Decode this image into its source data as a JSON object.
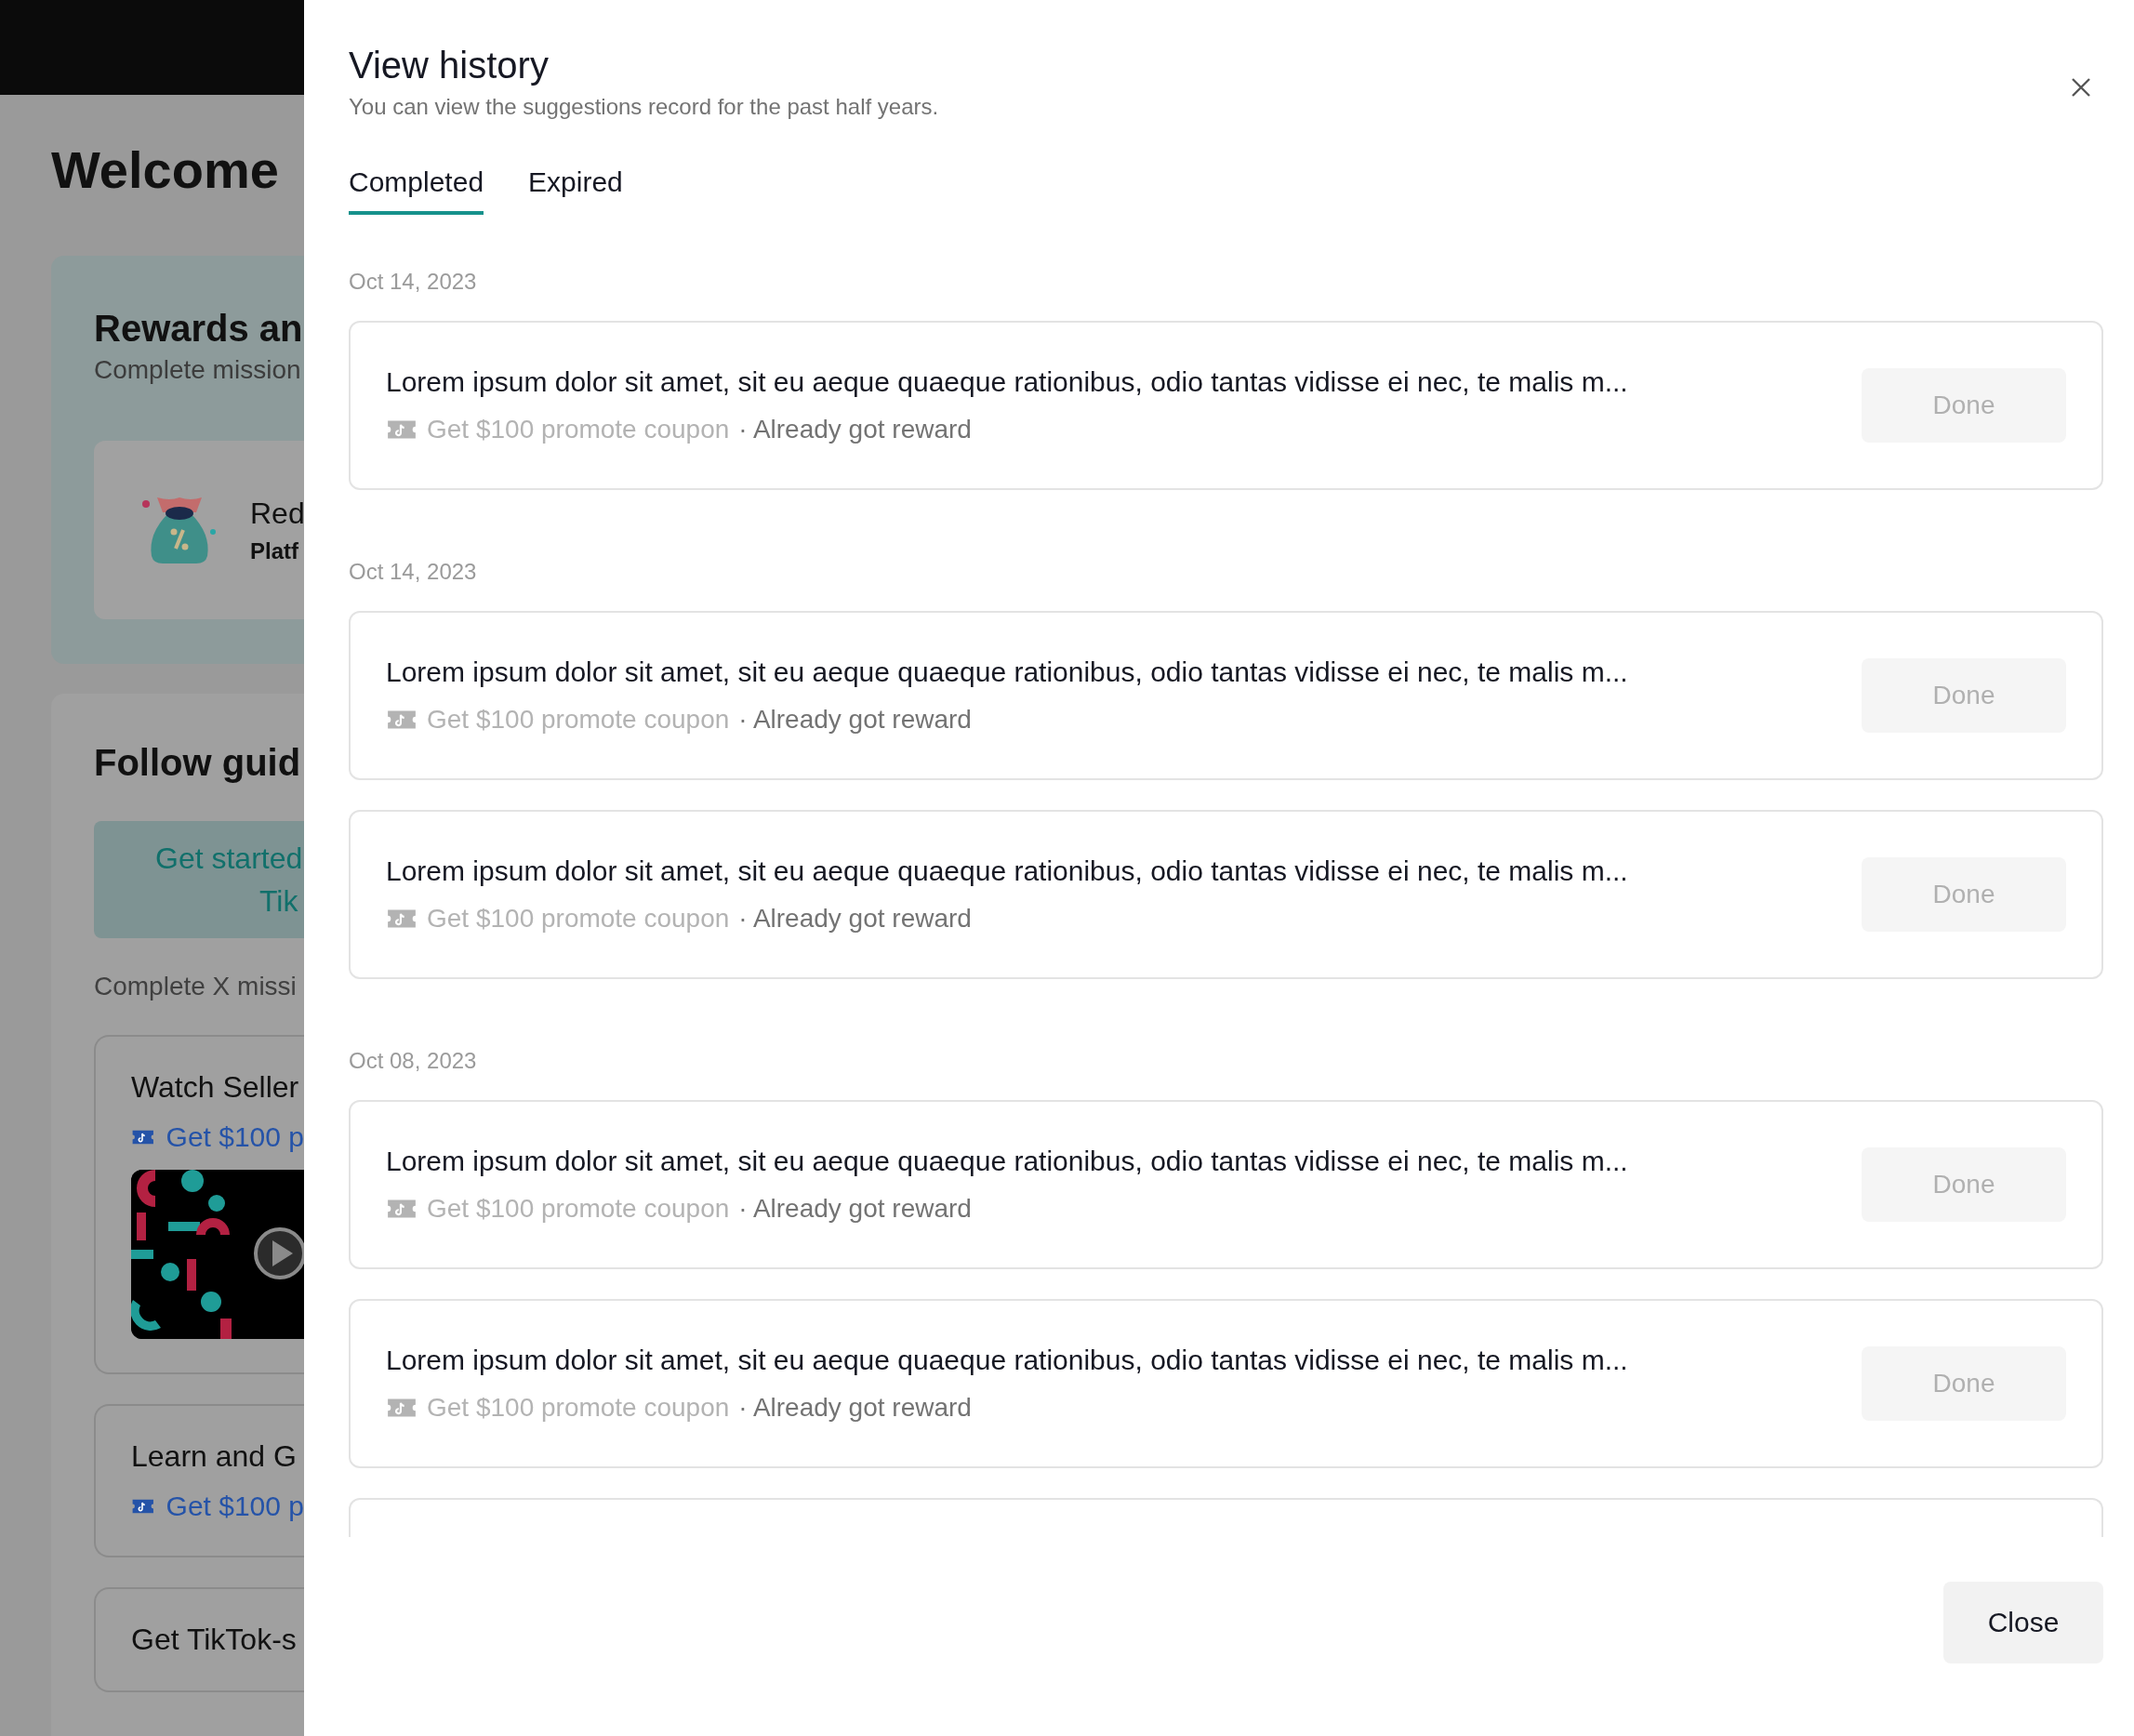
{
  "background_page": {
    "heading": "Welcome",
    "rewards_panel": {
      "title": "Rewards an",
      "subtitle": "Complete mission",
      "card": {
        "title": "Red",
        "subtitle": "Platf"
      }
    },
    "guide_panel": {
      "title": "Follow guid",
      "banner_lines": [
        "Get started",
        "Tik"
      ],
      "note": "Complete X missi",
      "missions": [
        {
          "title": "Watch Seller",
          "reward": "Get $100 p",
          "kind": "video"
        },
        {
          "title": "Learn and G",
          "reward": "Get $100 p",
          "kind": "plain"
        },
        {
          "title": "Get TikTok-s",
          "kind": "plain"
        }
      ]
    }
  },
  "drawer": {
    "title": "View history",
    "subtitle": "You can view the suggestions record for the past half years.",
    "tabs": [
      {
        "label": "Completed",
        "selected": true
      },
      {
        "label": "Expired",
        "selected": false
      }
    ],
    "groups": [
      {
        "date": "Oct 14, 2023",
        "items": [
          {
            "title": "Lorem ipsum dolor sit amet, sit eu aeque quaeque rationibus, odio tantas vidisse ei nec, te malis m...",
            "reward": "Get $100 promote coupon",
            "note": "· Already got reward",
            "button": "Done",
            "disabled": true
          }
        ]
      },
      {
        "date": "Oct 14, 2023",
        "items": [
          {
            "title": "Lorem ipsum dolor sit amet, sit eu aeque quaeque rationibus, odio tantas vidisse ei nec, te malis m...",
            "reward": "Get $100 promote coupon",
            "note": "· Already got reward",
            "button": "Done",
            "disabled": true
          },
          {
            "title": "Lorem ipsum dolor sit amet, sit eu aeque quaeque rationibus, odio tantas vidisse ei nec, te malis m...",
            "reward": "Get $100 promote coupon",
            "note": "· Already got reward",
            "button": "Done",
            "disabled": true
          }
        ]
      },
      {
        "date": "Oct 08, 2023",
        "items": [
          {
            "title": "Lorem ipsum dolor sit amet, sit eu aeque quaeque rationibus, odio tantas vidisse ei nec, te malis m...",
            "reward": "Get $100 promote coupon",
            "note": "· Already got reward",
            "button": "Done",
            "disabled": true
          },
          {
            "title": "Lorem ipsum dolor sit amet, sit eu aeque quaeque rationibus, odio tantas vidisse ei nec, te malis m...",
            "reward": "Get $100 promote coupon",
            "note": "· Already got reward",
            "button": "Done",
            "disabled": true
          }
        ]
      }
    ],
    "footer_button": "Close"
  }
}
